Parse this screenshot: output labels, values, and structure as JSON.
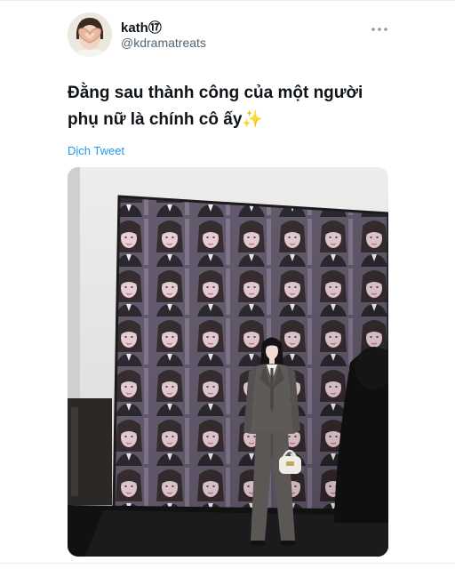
{
  "tweet": {
    "author": {
      "display_name": "kath⑰",
      "handle": "@kdramatreats",
      "avatar_icon": "profile-photo-heart-hands"
    },
    "more_icon": "more-horizontal-icon",
    "text_lines": [
      "Đằng sau thành công của một người",
      "phụ nữ là chính cô ấy✨"
    ],
    "translate_label": "Dịch Tweet",
    "media": {
      "image_icon": "photo-woman-in-front-of-led-wall"
    }
  },
  "colors": {
    "link": "#1d9bf0",
    "text": "#0f1419",
    "secondary": "#536471"
  }
}
